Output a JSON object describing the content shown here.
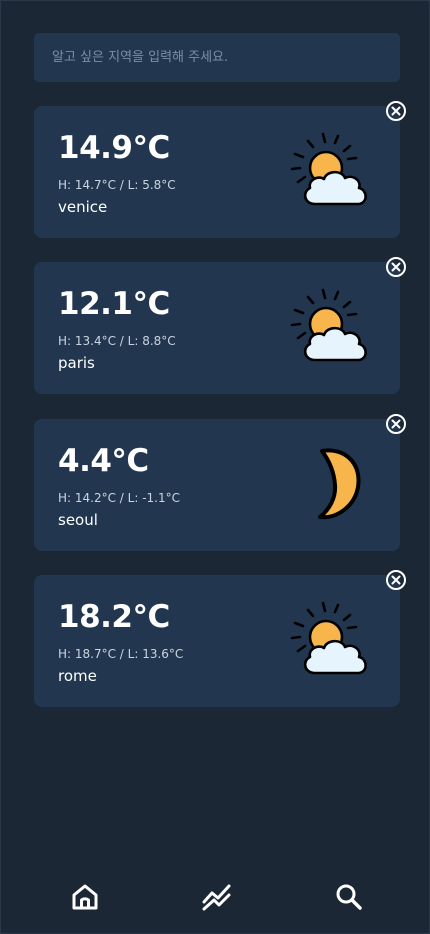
{
  "search": {
    "placeholder": "알고 싶은 지역을 입력해 주세요."
  },
  "cards": [
    {
      "temp": "14.9°C",
      "hilo": "H: 14.7°C / L: 5.8°C",
      "city": "venice",
      "icon": "partly-cloudy-icon"
    },
    {
      "temp": "12.1°C",
      "hilo": "H: 13.4°C / L: 8.8°C",
      "city": "paris",
      "icon": "partly-cloudy-icon"
    },
    {
      "temp": "4.4°C",
      "hilo": "H: 14.2°C / L: -1.1°C",
      "city": "seoul",
      "icon": "moon-icon"
    },
    {
      "temp": "18.2°C",
      "hilo": "H: 18.7°C / L: 13.6°C",
      "city": "rome",
      "icon": "partly-cloudy-icon"
    }
  ],
  "nav": {
    "items": [
      "home-icon",
      "chart-icon",
      "search-icon"
    ]
  },
  "colors": {
    "background": "#1c2735",
    "card": "#22374f",
    "sun": "#f7b54c",
    "cloud": "#e6f4fe"
  }
}
